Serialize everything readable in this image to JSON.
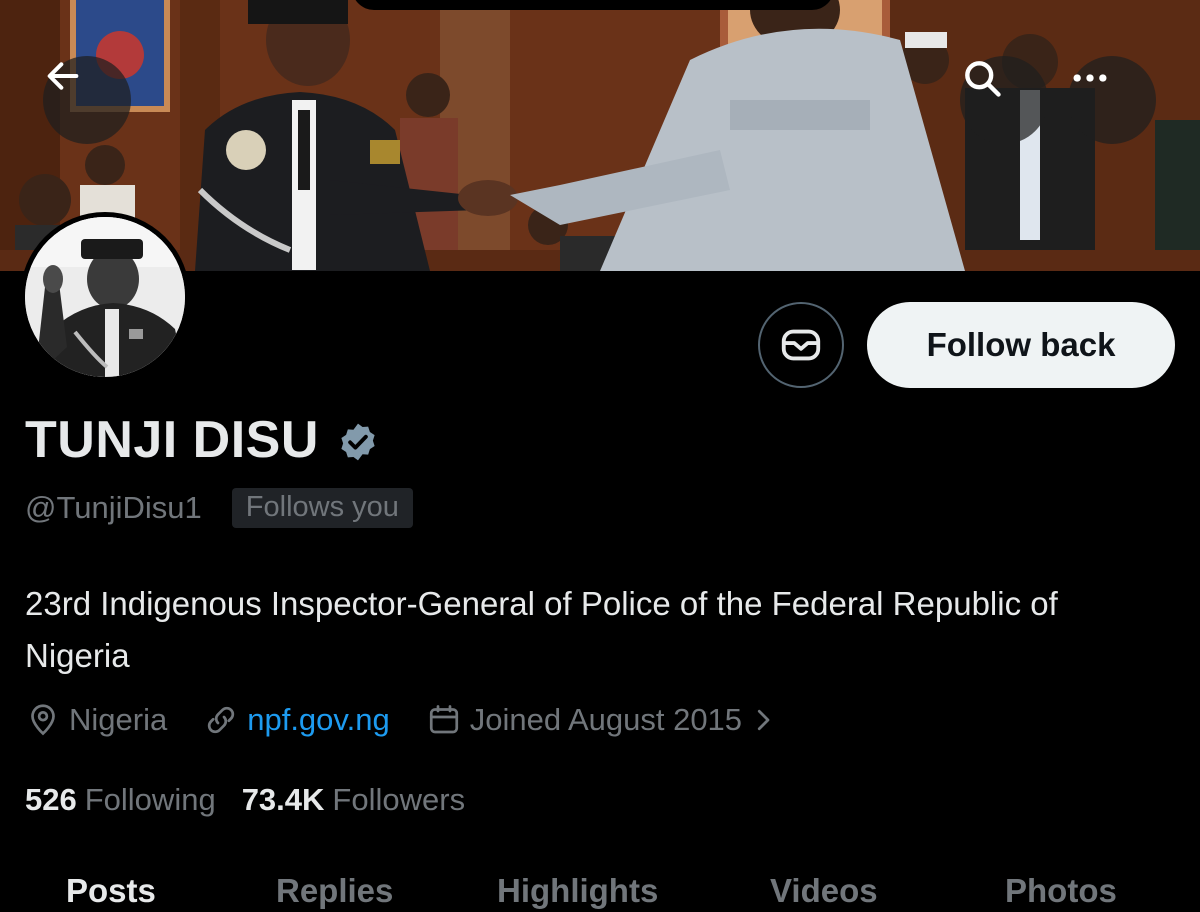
{
  "header": {
    "back_icon": "arrow-left-icon",
    "search_icon": "search-icon",
    "more_icon": "more-horizontal-icon"
  },
  "profile": {
    "name": "TUNJI DISU",
    "verified_icon": "verified-badge-icon",
    "verified_color": "#829aab",
    "handle": "@TunjiDisu1",
    "follows_you": "Follows you",
    "bio": "23rd Indigenous Inspector-General of Police of the Federal Republic of Nigeria",
    "location": "Nigeria",
    "website": "npf.gov.ng",
    "joined": "Joined August 2015",
    "following_count": "526",
    "following_label": "Following",
    "followers_count": "73.4K",
    "followers_label": "Followers"
  },
  "actions": {
    "message_icon": "message-icon",
    "follow_back_label": "Follow back"
  },
  "tabs": [
    {
      "label": "Posts",
      "active": true
    },
    {
      "label": "Replies",
      "active": false
    },
    {
      "label": "Highlights",
      "active": false
    },
    {
      "label": "Videos",
      "active": false
    },
    {
      "label": "Photos",
      "active": false
    }
  ],
  "colors": {
    "background": "#000000",
    "text_primary": "#e7e9ea",
    "text_secondary": "#71767b",
    "link": "#1d9bf0",
    "follow_button_bg": "#eff3f4"
  }
}
